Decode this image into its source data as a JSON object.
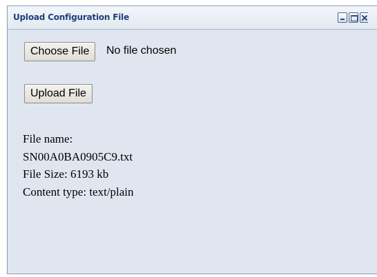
{
  "window": {
    "title": "Upload Configuration File"
  },
  "file_input": {
    "choose_label": "Choose File",
    "status": "No file chosen"
  },
  "upload": {
    "button_label": "Upload File"
  },
  "file_info": {
    "name_label": "File name:",
    "name_value": "SN00A0BA0905C9.txt",
    "size_text": "File Size: 6193 kb",
    "content_type_text": "Content type: text/plain"
  }
}
